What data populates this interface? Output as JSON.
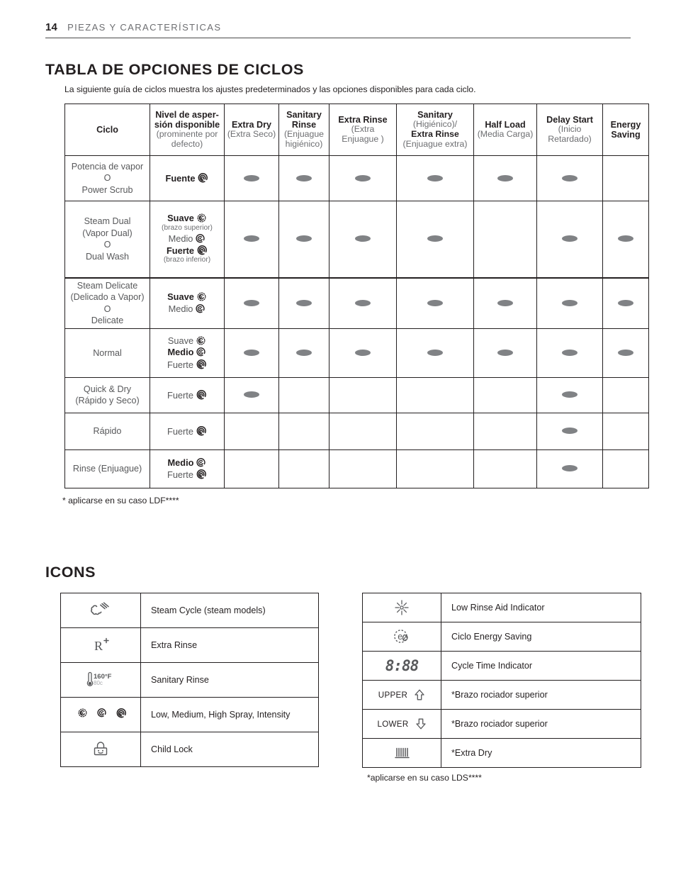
{
  "header": {
    "page_number": "14",
    "section": "PIEZAS Y CARACTERÍSTICAS"
  },
  "cycles_section": {
    "title": "TABLA DE OPCIONES DE CICLOS",
    "intro": "La siguiente guía de ciclos muestra los ajustes predeterminados y las opciones disponibles para cada ciclo.",
    "footnote": "* aplicarse en su caso LDF****",
    "columns": [
      {
        "en": "Ciclo",
        "es": ""
      },
      {
        "en": "Nivel de asper-sión disponible",
        "es": "(prominente por defecto)"
      },
      {
        "en": "Extra Dry",
        "es": "(Extra Seco)"
      },
      {
        "en": "Sanitary Rinse",
        "es": "(Enjuague higiénico)"
      },
      {
        "en": "Extra Rinse",
        "es": "(Extra Enjuague )"
      },
      {
        "en": "Sanitary",
        "es": "(Higiénico)/ Extra Rinse (Enjuague extra)"
      },
      {
        "en": "Half Load",
        "es": "(Media Carga)"
      },
      {
        "en": "Delay Start",
        "es": "(Inicio Retardado)"
      },
      {
        "en": "Energy Saving",
        "es": ""
      }
    ],
    "rows": [
      {
        "cycle_lines": [
          "Potencia de vapor",
          "O",
          "Power Scrub"
        ],
        "levels": [
          {
            "label": "Fuente",
            "bold": true,
            "icon": "spray-high-icon",
            "sub": ""
          }
        ],
        "dots": [
          true,
          true,
          true,
          true,
          true,
          true,
          false
        ]
      },
      {
        "cycle_lines": [
          "Steam Dual",
          "(Vapor Dual)",
          "O",
          "Dual Wash"
        ],
        "levels": [
          {
            "label": "Suave",
            "bold": true,
            "icon": "spray-low-icon",
            "sub": "(brazo superior)"
          },
          {
            "label": "Medio",
            "bold": false,
            "icon": "spray-medium-icon",
            "sub": ""
          },
          {
            "label": "Fuerte",
            "bold": true,
            "icon": "spray-high-icon",
            "sub": "(brazo inferior)"
          }
        ],
        "dots": [
          true,
          true,
          true,
          true,
          false,
          true,
          true
        ]
      },
      {
        "cycle_lines": [
          "Steam Delicate",
          "(Delicado a Vapor)",
          "O",
          "Delicate"
        ],
        "levels": [
          {
            "label": "Suave",
            "bold": true,
            "icon": "spray-low-icon",
            "sub": ""
          },
          {
            "label": "Medio",
            "bold": false,
            "icon": "spray-medium-icon",
            "sub": ""
          }
        ],
        "dots": [
          true,
          true,
          true,
          true,
          true,
          true,
          true
        ]
      },
      {
        "cycle_lines": [
          "Normal"
        ],
        "levels": [
          {
            "label": "Suave",
            "bold": false,
            "icon": "spray-low-icon",
            "sub": ""
          },
          {
            "label": "Medio",
            "bold": true,
            "icon": "spray-medium-icon",
            "sub": ""
          },
          {
            "label": "Fuerte",
            "bold": false,
            "icon": "spray-high-icon",
            "sub": ""
          }
        ],
        "dots": [
          true,
          true,
          true,
          true,
          true,
          true,
          true
        ]
      },
      {
        "cycle_lines": [
          "Quick & Dry",
          "(Rápido y Seco)"
        ],
        "levels": [
          {
            "label": "Fuerte",
            "bold": false,
            "icon": "spray-high-icon",
            "sub": ""
          }
        ],
        "dots": [
          true,
          false,
          false,
          false,
          false,
          true,
          false
        ]
      },
      {
        "cycle_lines": [
          "Rápido"
        ],
        "levels": [
          {
            "label": "Fuerte",
            "bold": false,
            "icon": "spray-high-icon",
            "sub": ""
          }
        ],
        "dots": [
          false,
          false,
          false,
          false,
          false,
          true,
          false
        ]
      },
      {
        "cycle_lines": [
          "Rinse (Enjuague)"
        ],
        "levels": [
          {
            "label": "Medio",
            "bold": true,
            "icon": "spray-medium-icon",
            "sub": ""
          },
          {
            "label": "Fuerte",
            "bold": false,
            "icon": "spray-high-icon",
            "sub": ""
          }
        ],
        "dots": [
          false,
          false,
          false,
          false,
          false,
          true,
          false
        ]
      }
    ]
  },
  "icons_section": {
    "title": "ICONS",
    "footnote": "*aplicarse en su caso LDS****",
    "left_rows": [
      {
        "icon": "steam-cloud-icon",
        "label": "Steam Cycle (steam models)"
      },
      {
        "icon": "extra-rinse-r-plus-icon",
        "label": "Extra Rinse"
      },
      {
        "icon": "thermometer-sanitary-icon",
        "label": "Sanitary Rinse",
        "temp_f": "160°F",
        "temp_c": "80c"
      },
      {
        "icon": "spray-intensity-trio-icon",
        "label": "Low, Medium, High Spray, Intensity"
      },
      {
        "icon": "child-lock-padlock-icon",
        "label": "Child Lock"
      }
    ],
    "right_rows": [
      {
        "icon": "low-rinse-aid-starburst-icon",
        "label": "Low Rinse Aid Indicator"
      },
      {
        "icon": "energy-saving-e-leaf-icon",
        "label": "Ciclo Energy Saving"
      },
      {
        "icon": "cycle-time-seven-segment-icon",
        "label": "Cycle Time Indicator",
        "display": "8:88"
      },
      {
        "icon": "upper-arrow-icon",
        "label": "*Brazo rociador superior",
        "word": "UPPER"
      },
      {
        "icon": "lower-arrow-icon",
        "label": "*Brazo rociador superior",
        "word": "LOWER"
      },
      {
        "icon": "extra-dry-heat-coil-icon",
        "label": "*Extra Dry"
      }
    ]
  },
  "colors": {
    "text": "#231f20",
    "muted": "#6d6e71",
    "cell_text": "#58595b",
    "dot": "#808285",
    "rule": "#4a4a4a"
  }
}
